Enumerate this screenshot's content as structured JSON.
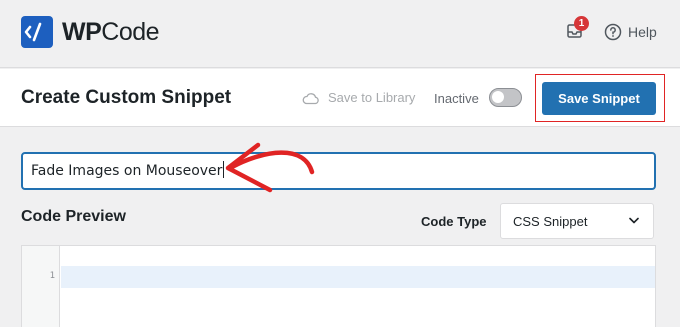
{
  "topbar": {
    "logo": {
      "wp": "WP",
      "code": "Code"
    },
    "notification_count": "1",
    "help_label": "Help"
  },
  "header": {
    "title": "Create Custom Snippet",
    "save_to_library": "Save to Library",
    "status_label": "Inactive",
    "toggle_on": false,
    "save_button": "Save Snippet"
  },
  "editor": {
    "snippet_title": "Fade Images on Mouseover",
    "code_preview_label": "Code Preview",
    "code_type_label": "Code Type",
    "code_type_value": "CSS Snippet",
    "line_numbers": [
      "1"
    ]
  },
  "colors": {
    "brand": "#1d5fbf",
    "primary_button": "#2271b1",
    "annotation": "#e02424",
    "badge": "#d63638"
  }
}
